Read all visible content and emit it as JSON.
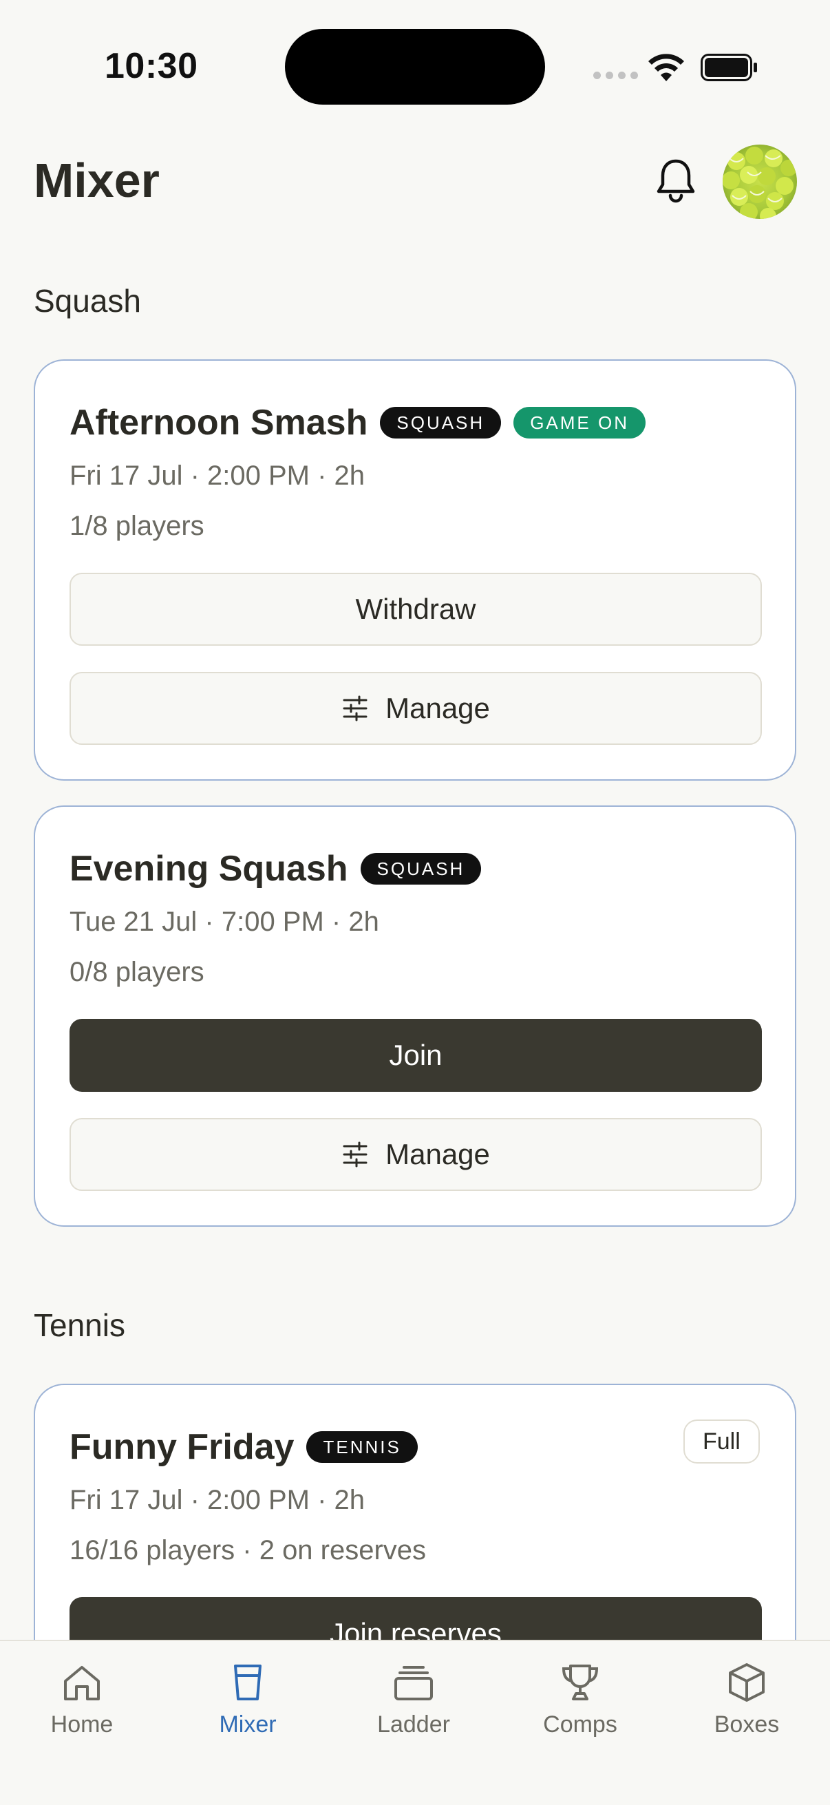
{
  "status_bar": {
    "time": "10:30"
  },
  "header": {
    "title": "Mixer"
  },
  "sections": [
    {
      "title": "Squash",
      "cards": [
        {
          "title": "Afternoon Smash",
          "tags": [
            "SQUASH",
            "GAME ON"
          ],
          "when": "Fri 17 Jul · 2:00 PM · 2h",
          "players": "1/8 players",
          "primary_button": "Withdraw",
          "manage_button": "Manage"
        },
        {
          "title": "Evening Squash",
          "tags": [
            "SQUASH"
          ],
          "when": "Tue 21 Jul · 7:00 PM · 2h",
          "players": "0/8 players",
          "primary_button": "Join",
          "manage_button": "Manage"
        }
      ]
    },
    {
      "title": "Tennis",
      "cards": [
        {
          "title": "Funny Friday",
          "tags": [
            "TENNIS"
          ],
          "badge": "Full",
          "when": "Fri 17 Jul · 2:00 PM · 2h",
          "players": "16/16 players · 2 on reserves",
          "primary_button": "Join reserves"
        }
      ]
    }
  ],
  "tab_bar": {
    "active": "Mixer",
    "items": [
      {
        "label": "Home",
        "icon": "home-icon"
      },
      {
        "label": "Mixer",
        "icon": "cup-icon"
      },
      {
        "label": "Ladder",
        "icon": "ladder-icon"
      },
      {
        "label": "Comps",
        "icon": "trophy-icon"
      },
      {
        "label": "Boxes",
        "icon": "box-icon"
      }
    ]
  },
  "colors": {
    "background": "#f8f8f5",
    "card_border": "#9db3d6",
    "game_on": "#15966b",
    "dark_button": "#3a3930",
    "active_tab": "#2f6bb5"
  }
}
